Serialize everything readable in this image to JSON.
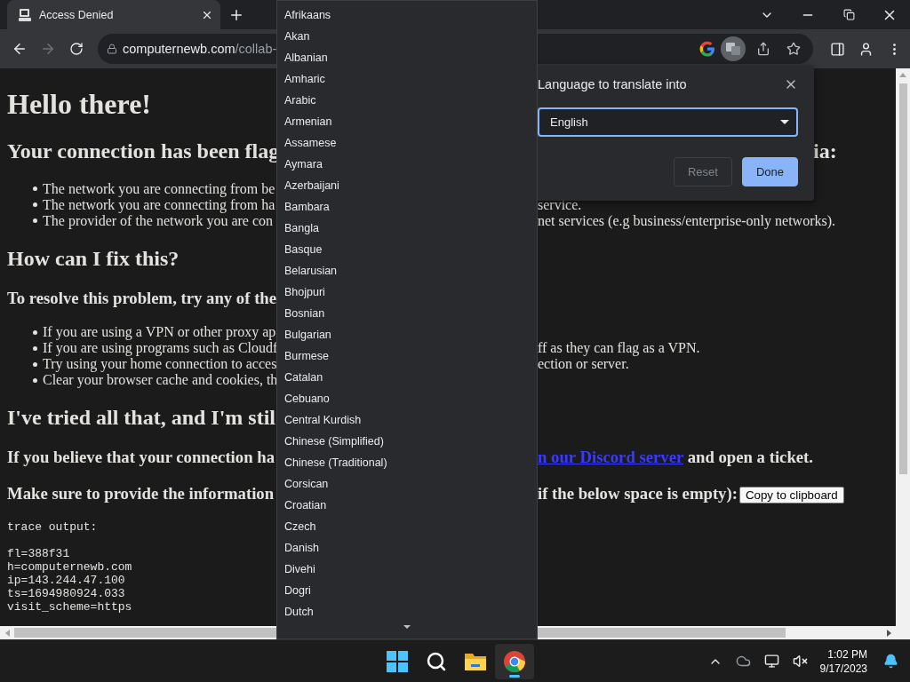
{
  "browser": {
    "tab": {
      "title": "Access Denied",
      "selected": true
    },
    "nav": {
      "back_disabled": false,
      "forward_disabled": true
    },
    "address": {
      "host": "computernewb.com",
      "path": "/collab-"
    },
    "translate_active": true
  },
  "page": {
    "blocks": [
      {
        "kind": "h1",
        "left": "Hello there!"
      },
      {
        "kind": "h2",
        "left": "Your connection has been flag",
        "right": "ia:"
      },
      {
        "kind": "list",
        "items": [
          {
            "left": "The network you are connecting from be"
          },
          {
            "left": "The network you are connecting from ha",
            "right": "service."
          },
          {
            "left": "The provider of the network you are con",
            "right": "net services (e.g business/enterprise-only networks)."
          }
        ]
      },
      {
        "kind": "h2",
        "left": "How can I fix this?"
      },
      {
        "kind": "h3",
        "left": "To resolve this problem, try any of the"
      },
      {
        "kind": "list",
        "items": [
          {
            "left": "If you are using a VPN or other proxy ap"
          },
          {
            "left": "If you are using programs such as Cloudf",
            "right": "ff as they can flag as a VPN."
          },
          {
            "left": "Try using your home connection to acces",
            "right": "ection or server."
          },
          {
            "left": "Clear your browser cache and cookies, th"
          }
        ]
      },
      {
        "kind": "h2",
        "left": "I've tried all that, and I'm stil"
      },
      {
        "kind": "h3",
        "left": "If you believe that your connection ha",
        "link": "n our Discord server",
        "right": " and open a ticket."
      },
      {
        "kind": "h3",
        "left": "Make sure to provide the information",
        "right": "if the below space is empty):",
        "button": "Copy to clipboard"
      }
    ],
    "trace": {
      "heading": "trace output:",
      "lines": [
        {
          "left": "fl=388f31"
        },
        {
          "left": "h=computernewb.com"
        },
        {
          "left": "ip=143.244.47.100"
        },
        {
          "left": "ts=1694980924.033"
        },
        {
          "left": "visit_scheme=https"
        }
      ]
    }
  },
  "translate_popup": {
    "title": "Language to translate into",
    "select": {
      "value": "English",
      "open": true
    },
    "buttons": [
      {
        "label": "Reset",
        "kind": "secondary",
        "disabled": true
      },
      {
        "label": "Done",
        "kind": "primary",
        "disabled": false
      }
    ]
  },
  "language_menu": {
    "items": [
      "Afrikaans",
      "Akan",
      "Albanian",
      "Amharic",
      "Arabic",
      "Armenian",
      "Assamese",
      "Aymara",
      "Azerbaijani",
      "Bambara",
      "Bangla",
      "Basque",
      "Belarusian",
      "Bhojpuri",
      "Bosnian",
      "Bulgarian",
      "Burmese",
      "Catalan",
      "Cebuano",
      "Central Kurdish",
      "Chinese (Simplified)",
      "Chinese (Traditional)",
      "Corsican",
      "Croatian",
      "Czech",
      "Danish",
      "Divehi",
      "Dogri",
      "Dutch"
    ]
  },
  "taskbar": {
    "apps": [
      {
        "kind": "start",
        "selected": false
      },
      {
        "kind": "search",
        "selected": false
      },
      {
        "kind": "explorer",
        "selected": false
      },
      {
        "kind": "chrome",
        "selected": true
      }
    ],
    "clock": {
      "time": "1:02 PM",
      "date": "9/17/2023"
    }
  }
}
